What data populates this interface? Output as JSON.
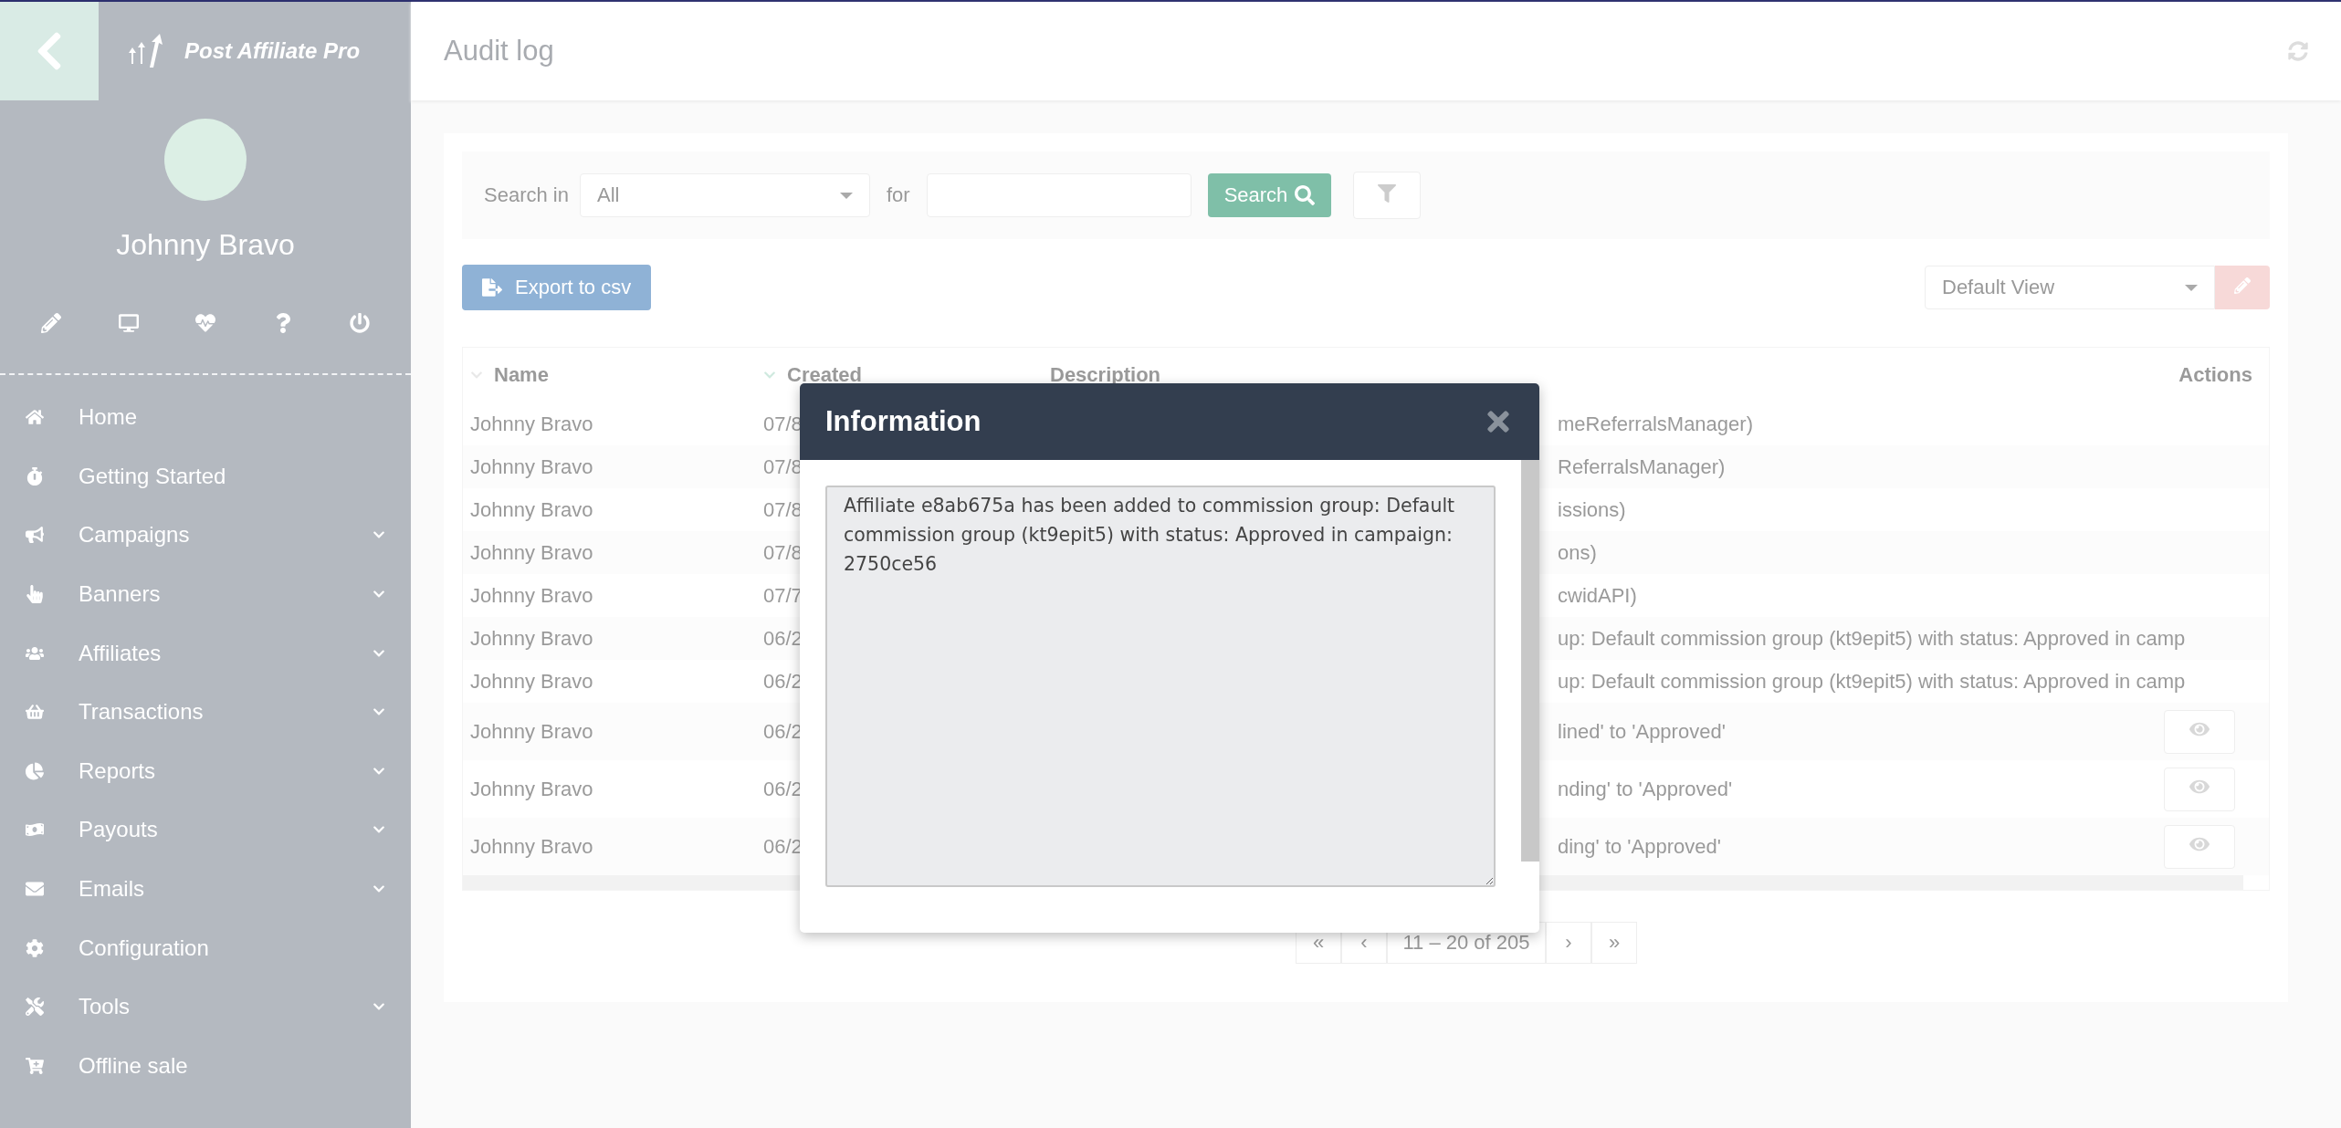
{
  "sidebar": {
    "logo": "Post Affiliate Pro",
    "user_name": "Johnny Bravo",
    "menu": [
      {
        "label": "Home",
        "has_submenu": false
      },
      {
        "label": "Getting Started",
        "has_submenu": false
      },
      {
        "label": "Campaigns",
        "has_submenu": true
      },
      {
        "label": "Banners",
        "has_submenu": true
      },
      {
        "label": "Affiliates",
        "has_submenu": true
      },
      {
        "label": "Transactions",
        "has_submenu": true
      },
      {
        "label": "Reports",
        "has_submenu": true
      },
      {
        "label": "Payouts",
        "has_submenu": true
      },
      {
        "label": "Emails",
        "has_submenu": true
      },
      {
        "label": "Configuration",
        "has_submenu": false
      },
      {
        "label": "Tools",
        "has_submenu": true
      },
      {
        "label": "Offline sale",
        "has_submenu": false
      }
    ]
  },
  "header": {
    "title": "Audit log"
  },
  "search": {
    "label": "Search in",
    "scope": "All",
    "for_label": "for",
    "button": "Search"
  },
  "export_button": "Export to csv",
  "view_select": "Default View",
  "table": {
    "columns": [
      "Name",
      "Created",
      "Description",
      "Actions"
    ],
    "rows": [
      {
        "name": "Johnny Bravo",
        "created": "07/8",
        "description": "meReferralsManager)",
        "has_view_button": false
      },
      {
        "name": "Johnny Bravo",
        "created": "07/8",
        "description": "ReferralsManager)",
        "has_view_button": false
      },
      {
        "name": "Johnny Bravo",
        "created": "07/8",
        "description": "issions)",
        "has_view_button": false
      },
      {
        "name": "Johnny Bravo",
        "created": "07/8",
        "description": "ons)",
        "has_view_button": false
      },
      {
        "name": "Johnny Bravo",
        "created": "07/7",
        "description": "cwidAPI)",
        "has_view_button": false
      },
      {
        "name": "Johnny Bravo",
        "created": "06/2",
        "description": "up: Default commission group (kt9epit5) with status: Approved in camp",
        "has_view_button": false
      },
      {
        "name": "Johnny Bravo",
        "created": "06/2",
        "description": "up: Default commission group (kt9epit5) with status: Approved in camp",
        "has_view_button": false
      },
      {
        "name": "Johnny Bravo",
        "created": "06/2",
        "description": "lined' to 'Approved'",
        "has_view_button": true
      },
      {
        "name": "Johnny Bravo",
        "created": "06/2",
        "description": "nding' to 'Approved'",
        "has_view_button": true
      },
      {
        "name": "Johnny Bravo",
        "created": "06/2",
        "description": "ding' to 'Approved'",
        "has_view_button": true
      }
    ]
  },
  "pagination": {
    "first": "«",
    "prev": "‹",
    "range": "11 – 20 of 205",
    "next": "›",
    "last": "»"
  },
  "dialog": {
    "title": "Information",
    "message": "Affiliate e8ab675a has been added to commission group: Default commission group (kt9epit5) with status: Approved in campaign: 2750ce56"
  }
}
